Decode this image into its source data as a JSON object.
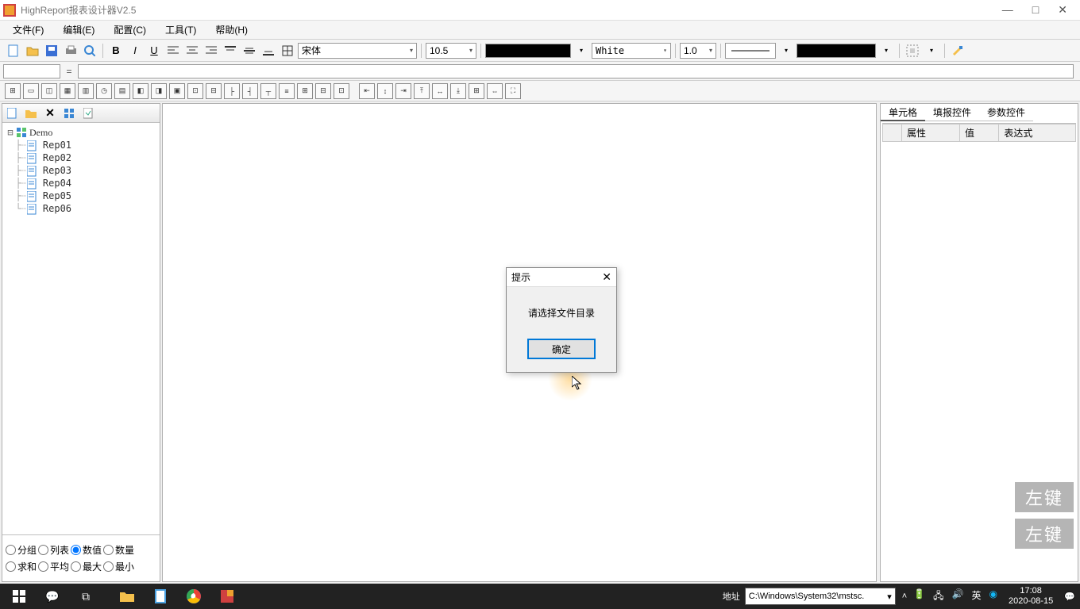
{
  "titlebar": {
    "title": "HighReport报表设计器V2.5"
  },
  "menu": {
    "file": "文件(F)",
    "edit": "编辑(E)",
    "config": "配置(C)",
    "tool": "工具(T)",
    "help": "帮助(H)"
  },
  "toolbar1": {
    "font": "宋体",
    "fontSize": "10.5",
    "bgColor": "White",
    "lineWidth": "1.0"
  },
  "tree": {
    "root": "Demo",
    "items": [
      "Rep01",
      "Rep02",
      "Rep03",
      "Rep04",
      "Rep05",
      "Rep06"
    ]
  },
  "leftOpts": {
    "row1": [
      "分组",
      "列表",
      "数值",
      "数量"
    ],
    "row2": [
      "求和",
      "平均",
      "最大",
      "最小"
    ],
    "selected": "数值"
  },
  "rightTabs": {
    "t1": "单元格",
    "t2": "填报控件",
    "t3": "参数控件"
  },
  "rightGrid": {
    "headers": [
      "",
      "属性",
      "值",
      "表达式"
    ]
  },
  "dialog": {
    "title": "提示",
    "message": "请选择文件目录",
    "ok": "确定"
  },
  "watermark": "左键",
  "taskbar": {
    "addrLabel": "地址",
    "addrValue": "C:\\Windows\\System32\\mstsc.",
    "lang": "英",
    "time": "17:08",
    "date": "2020-08-15"
  }
}
